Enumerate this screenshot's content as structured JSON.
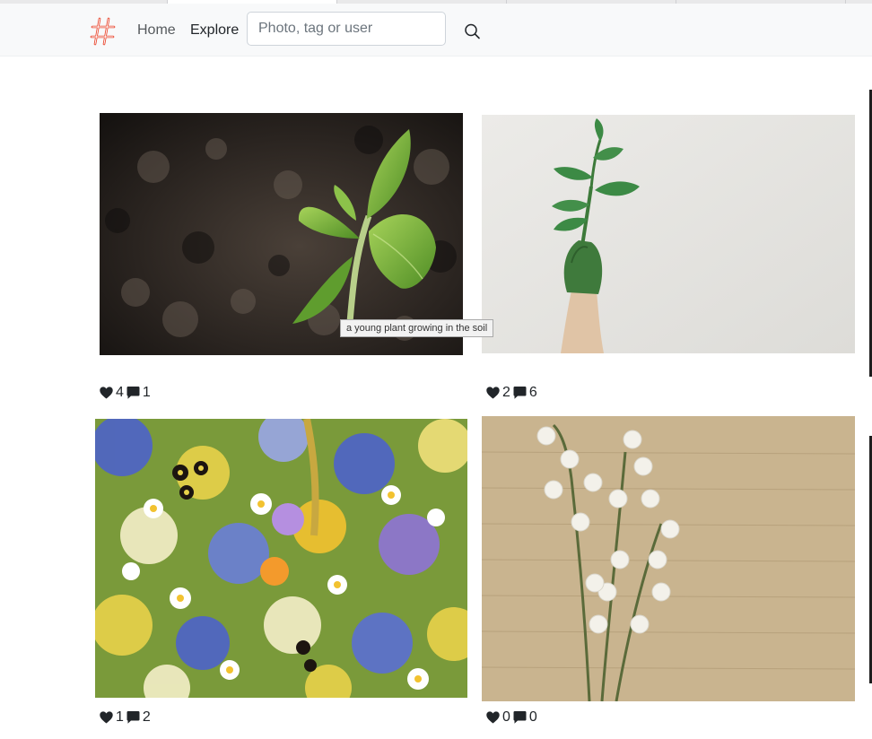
{
  "nav": {
    "brand_icon": "hashtag-logo-icon",
    "home": "Home",
    "explore": "Explore",
    "search_placeholder": "Photo, tag or user",
    "search_value": "",
    "search_icon": "search-icon"
  },
  "colors": {
    "navbar_bg": "#f8f9fa",
    "brand": "#e8442c",
    "text": "#212529"
  },
  "photos": [
    {
      "likes": "4",
      "comments": "1",
      "tooltip": "a young plant growing in the soil"
    },
    {
      "likes": "2",
      "comments": "6"
    },
    {
      "likes": "1",
      "comments": "2"
    },
    {
      "likes": "0",
      "comments": "0"
    }
  ],
  "stat_icons": {
    "like": "heart-icon",
    "comment": "comment-icon"
  }
}
